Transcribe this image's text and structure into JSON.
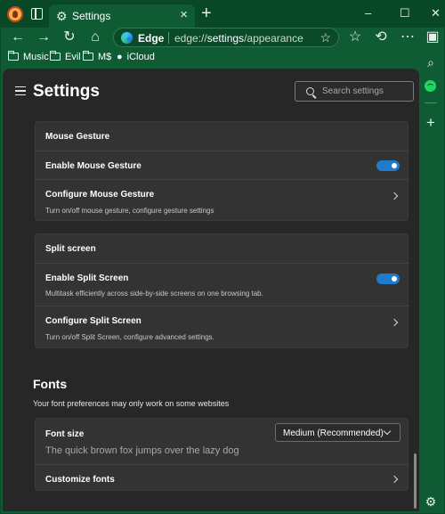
{
  "window": {
    "tab_title": "Settings",
    "controls": {
      "minimize": "–",
      "maximize": "☐",
      "close": "✕"
    }
  },
  "toolbar": {
    "address_label": "Edge",
    "url_prefix": "edge://",
    "url_bold": "settings",
    "url_suffix": "/appearance"
  },
  "bookmarks": [
    "Music",
    "Evil",
    "M$",
    "iCloud"
  ],
  "settings": {
    "title": "Settings",
    "search_placeholder": "Search settings",
    "mouse_gesture": {
      "section_title": "Mouse Gesture",
      "enable_label": "Enable Mouse Gesture",
      "enable_on": true,
      "configure_label": "Configure Mouse Gesture",
      "configure_desc": "Turn on/off mouse gesture, configure gesture settings"
    },
    "split_screen": {
      "section_title": "Split screen",
      "enable_label": "Enable Split Screen",
      "enable_desc": "Multitask efficiently across side-by-side screens on one browsing tab.",
      "enable_on": true,
      "configure_label": "Configure Split Screen",
      "configure_desc": "Turn on/off Split Screen, configure advanced settings."
    },
    "fonts": {
      "title": "Fonts",
      "desc": "Your font preferences may only work on some websites",
      "font_size_label": "Font size",
      "font_size_value": "Medium (Recommended)",
      "sample_text": "The quick brown fox jumps over the lazy dog",
      "customize_label": "Customize fonts"
    }
  },
  "colors": {
    "frame": "#0f5c34",
    "panel": "#272727",
    "card": "#333333",
    "toggle_on": "#1f7ccc"
  }
}
